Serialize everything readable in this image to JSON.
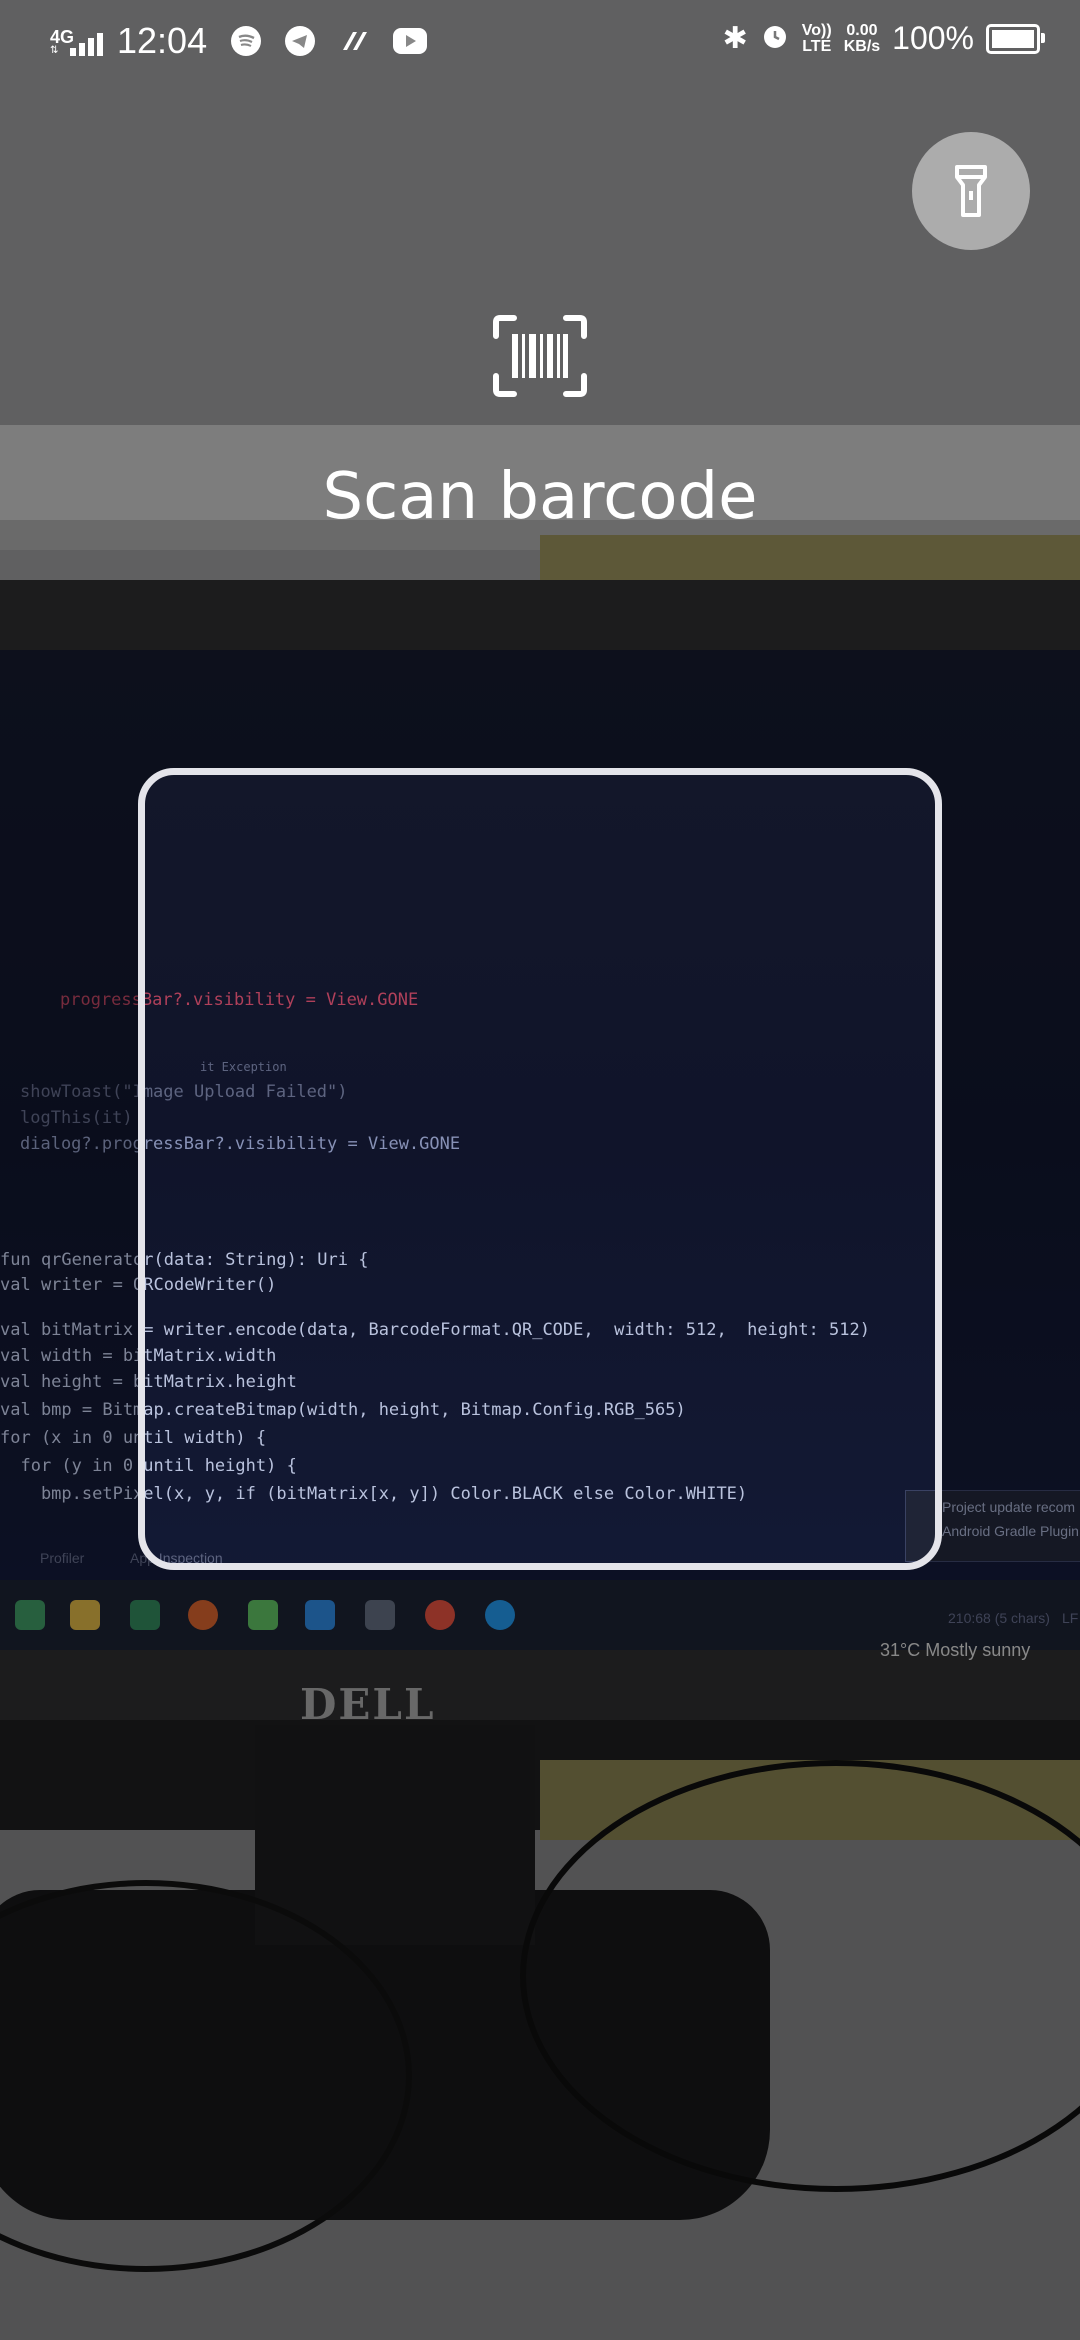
{
  "status_bar": {
    "network": "4G",
    "time": "12:04",
    "apps": [
      "spotify-icon",
      "telegram-icon",
      "paytm-icon",
      "youtube-icon"
    ],
    "volte_top": "Vo))",
    "volte_bottom": "LTE",
    "speed_value": "0.00",
    "speed_unit": "KB/s",
    "battery": "100%"
  },
  "scanner": {
    "title": "Scan barcode",
    "flashlight_icon": "flashlight-icon",
    "header_icon": "barcode-scan-icon"
  },
  "camera_view": {
    "code_lines": [
      "progressBar?.visibility = View.GONE",
      "it Exception",
      "showToast(\"Image Upload Failed\")",
      "logThis(it)",
      "dialog?.progressBar?.visibility = View.GONE",
      "fun qrGenerator(data: String): Uri {",
      "val writer = QRCodeWriter()",
      "val bitMatrix = writer.encode(data, BarcodeFormat.QR_CODE,  width: 512,  height: 512)",
      "val width = bitMatrix.width",
      "val height = bitMatrix.height",
      "val bmp = Bitmap.createBitmap(width, height, Bitmap.Config.RGB_565)",
      "for (x in 0 until width) {",
      "  for (y in 0 until height) {",
      "    bmp.setPixel(x, y, if (bitMatrix[x, y]) Color.BLACK else Color.WHITE)"
    ],
    "profiler": "Profiler",
    "app_inspection": "App Inspection",
    "popup_title": "Project update recom",
    "popup_sub": "Android Gradle Plugin",
    "char_count": "210:68 (5 chars)",
    "line_ending": "LF",
    "weather": "31°C  Mostly sunny",
    "brand": "DELL"
  }
}
